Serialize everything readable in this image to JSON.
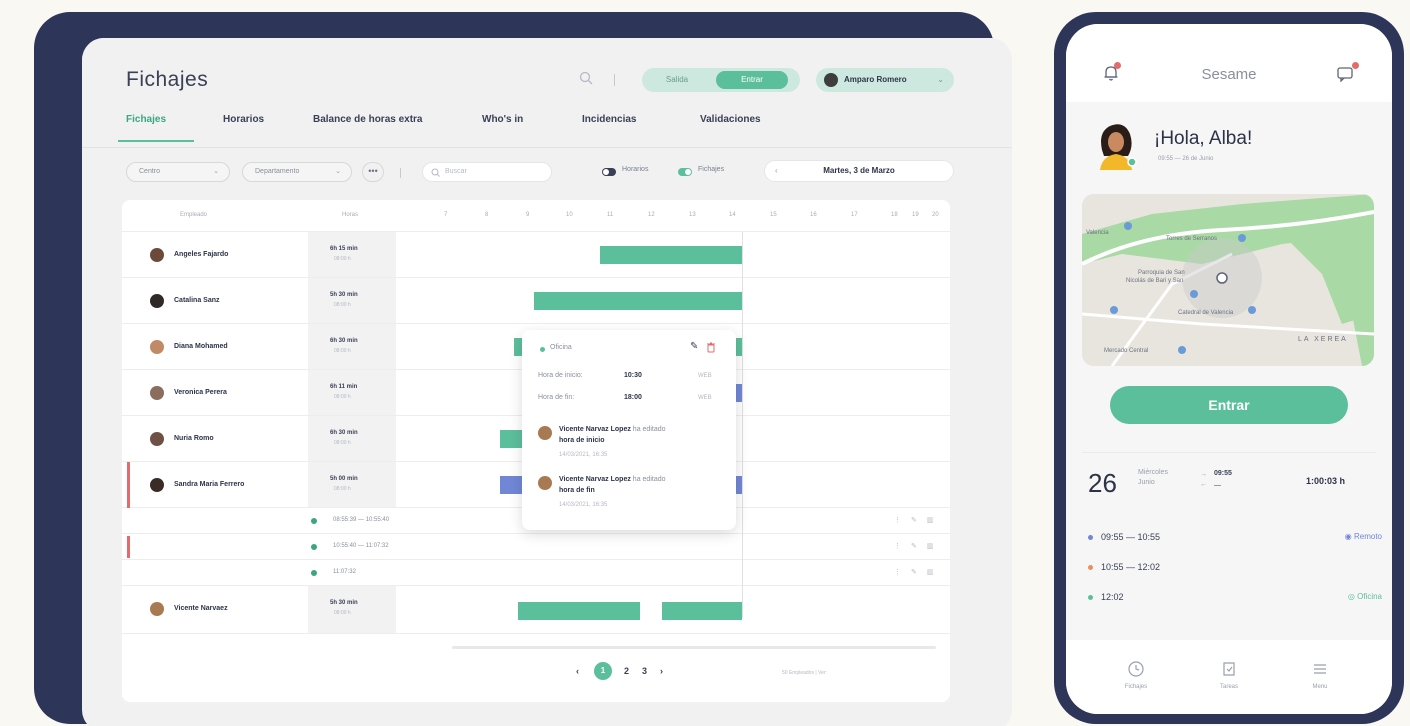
{
  "desktop": {
    "title": "Fichajes",
    "toggle": {
      "left": "Salida",
      "right": "Entrar"
    },
    "user": {
      "name": "Amparo Romero"
    },
    "tabs": [
      "Fichajes",
      "Horarios",
      "Balance de horas extra",
      "Who's in",
      "Incidencias",
      "Validaciones"
    ],
    "filters": {
      "center": "Centro",
      "department": "Departamento",
      "more": "•••",
      "search_placeholder": "Buscar",
      "horarios_toggle": "Horarios",
      "fichajes_toggle": "Fichajes",
      "date": "Martes, 3 de Marzo"
    },
    "table": {
      "headers": {
        "employee": "Empleado",
        "hours": "Horas"
      },
      "hour_ticks": [
        "7",
        "8",
        "9",
        "10",
        "11",
        "12",
        "13",
        "14",
        "15",
        "16",
        "17",
        "18",
        "19",
        "20"
      ],
      "rows": [
        {
          "name": "Angeles Fajardo",
          "hours": "6h 15 min",
          "sub": "08:00 h"
        },
        {
          "name": "Catalina Sanz",
          "hours": "5h 30 min",
          "sub": "08:00 h"
        },
        {
          "name": "Diana Mohamed",
          "hours": "6h 30 min",
          "sub": "08:00 h"
        },
        {
          "name": "Veronica Perera",
          "hours": "6h 11 min",
          "sub": "08:00 h"
        },
        {
          "name": "Nuria Romo",
          "hours": "6h 30 min",
          "sub": "08:00 h"
        },
        {
          "name": "Sandra Maria Ferrero",
          "hours": "5h 00 min",
          "sub": "08:00 h"
        }
      ],
      "sub_rows": [
        "08:55:39 — 10:55:40",
        "10:55:40 — 11:07:32",
        "11:07:32"
      ],
      "last_row": {
        "name": "Vicente Narvaez",
        "hours": "5h 30 min",
        "sub": "08:00 h"
      },
      "pagination": {
        "prev": "‹",
        "current": "1",
        "p2": "2",
        "p3": "3",
        "next": "›"
      },
      "per_page": "50 Empleados  |  Ver:"
    },
    "popup": {
      "location": "Oficina",
      "start_label": "Hora de inicio:",
      "start_value": "10:30",
      "start_tz": "WEB",
      "end_label": "Hora de fin:",
      "end_value": "18:00",
      "end_tz": "WEB",
      "edit1_name": "Vicente Narvaz Lopez",
      "edit1_action": "ha editado",
      "edit1_field": "hora de inicio",
      "edit1_date": "14/03/2021, 16:35",
      "edit2_name": "Vicente Narvaz Lopez",
      "edit2_action": "ha editado",
      "edit2_field": "hora de fin",
      "edit2_date": "14/03/2021, 16:35"
    }
  },
  "mobile": {
    "app_title": "Sesame",
    "greeting": "¡Hola, Alba!",
    "greeting_sub": "09:55 — 26 de Junio",
    "map_labels": {
      "l1": "Torres de Serranos",
      "l2": "Parroquia de San",
      "l3": "Nicolás de Bari y San",
      "l4": "Catedral de Valencia",
      "l5": "LA XEREA",
      "l6": "Mercado Central",
      "l7": "Valencia"
    },
    "button": "Entrar",
    "day_number": "26",
    "day_name": "Miércoles",
    "month": "Junio",
    "in_time": "09:55",
    "out_time": "—",
    "total": "1:00:03 h",
    "entries": [
      {
        "range": "09:55 — 10:55",
        "tag": "Remoto",
        "color": "#7187d6"
      },
      {
        "range": "10:55 — 12:02",
        "tag": "",
        "color": "#e8915e"
      },
      {
        "range": "12:02",
        "tag": "Oficina",
        "color": "#5cbf9c"
      }
    ],
    "nav": {
      "n1": "Fichajes",
      "n2": "Tareas",
      "n3": "Menu"
    }
  },
  "colors": {
    "accent": "#5cbf9c",
    "frame": "#2d3558",
    "blue_bar": "#7187d6",
    "alert": "#e36b6b"
  }
}
